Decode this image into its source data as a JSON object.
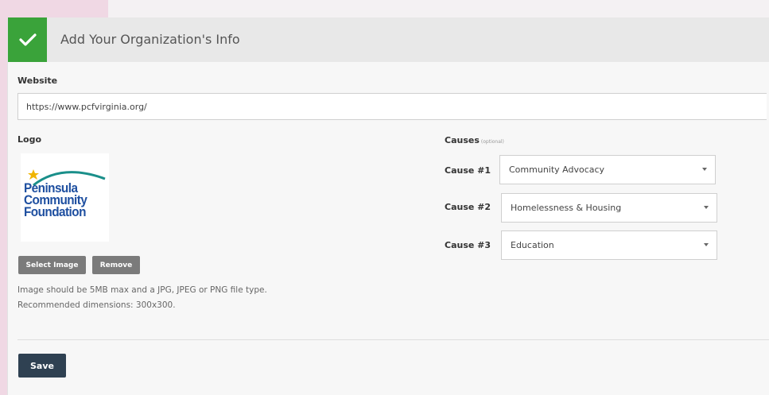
{
  "header": {
    "title": "Add Your Organization's Info"
  },
  "website": {
    "label": "Website",
    "value": "https://www.pcfvirginia.org/"
  },
  "logo": {
    "label": "Logo",
    "image_text": [
      "Peninsula",
      "Community",
      "Foundation"
    ],
    "select_label": "Select Image",
    "remove_label": "Remove",
    "help": [
      "Image should be 5MB max and a JPG, JPEG or PNG file type.",
      "Recommended dimensions: 300x300."
    ]
  },
  "causes": {
    "label": "Causes",
    "optional": "(optional)",
    "items": [
      {
        "label": "Cause #1",
        "value": "Community Advocacy"
      },
      {
        "label": "Cause #2",
        "value": "Homelessness & Housing"
      },
      {
        "label": "Cause #3",
        "value": "Education"
      }
    ]
  },
  "save_label": "Save",
  "colors": {
    "accent_green": "#3aa33a",
    "save_navy": "#2f4152",
    "logo_blue": "#1e4fa0",
    "logo_teal": "#1a8f8a",
    "logo_star": "#f0b500"
  },
  "icons": {
    "complete": "checkmark-icon",
    "dropdown": "caret-down-icon",
    "logo_star": "star-icon"
  }
}
